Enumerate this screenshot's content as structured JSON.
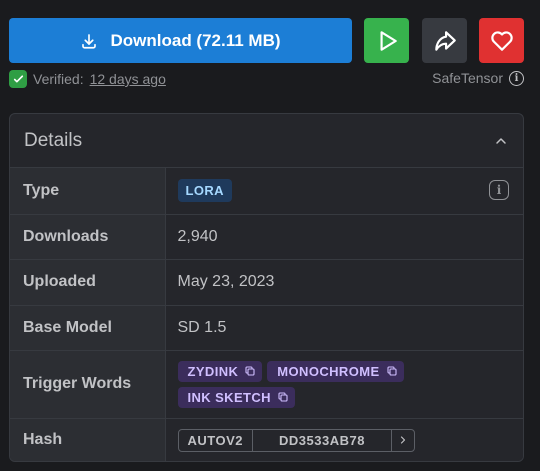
{
  "download": {
    "label": "Download (72.11 MB)"
  },
  "actions": {
    "play_icon": "play-icon",
    "share_icon": "share-icon",
    "like_icon": "heart-icon"
  },
  "verification": {
    "label": "Verified:",
    "when": "12 days ago"
  },
  "format": {
    "label": "SafeTensor"
  },
  "details": {
    "title": "Details",
    "rows": {
      "type": {
        "label": "Type",
        "value": "LORA"
      },
      "downloads": {
        "label": "Downloads",
        "value": "2,940"
      },
      "uploaded": {
        "label": "Uploaded",
        "value": "May 23, 2023"
      },
      "base_model": {
        "label": "Base Model",
        "value": "SD 1.5"
      },
      "trigger_words": {
        "label": "Trigger Words",
        "words": [
          "ZYDINK",
          "MONOCHROME",
          "INK SKETCH"
        ]
      },
      "hash": {
        "label": "Hash",
        "type": "AUTOV2",
        "value": "DD3533AB78"
      }
    }
  },
  "colors": {
    "download": "#1c7ed6",
    "play": "#37b24d",
    "share": "#373a40",
    "like": "#e03131",
    "verified": "#2f9e44",
    "badge_bg": "#1f3a5c",
    "trigger_bg": "#3b2d5c"
  }
}
